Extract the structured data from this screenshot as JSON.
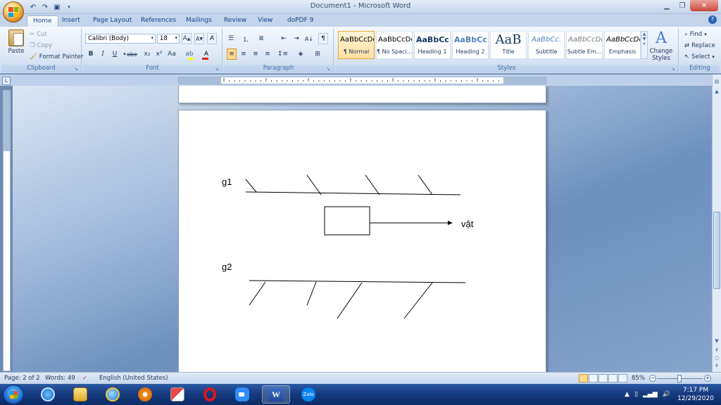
{
  "window": {
    "title": "Document1 - Microsoft Word"
  },
  "tabs": [
    "Home",
    "Insert",
    "Page Layout",
    "References",
    "Mailings",
    "Review",
    "View",
    "doPDF 9"
  ],
  "clipboard": {
    "label": "Clipboard",
    "paste": "Paste",
    "cut": "Cut",
    "copy": "Copy",
    "format_painter": "Format Painter"
  },
  "font": {
    "label": "Font",
    "family": "Calibri (Body)",
    "size": "18",
    "bold": "B",
    "italic": "I",
    "underline": "U",
    "strike": "abe",
    "subscript": "x₂",
    "superscript": "x²",
    "change_case": "Aa",
    "grow": "A",
    "shrink": "A"
  },
  "paragraph": {
    "label": "Paragraph"
  },
  "styles": {
    "label": "Styles",
    "items": [
      {
        "preview": "AaBbCcDc",
        "name": "¶ Normal"
      },
      {
        "preview": "AaBbCcDc",
        "name": "¶ No Spaci..."
      },
      {
        "preview": "AaBbCc",
        "name": "Heading 1"
      },
      {
        "preview": "AaBbCc",
        "name": "Heading 2"
      },
      {
        "preview": "AaB",
        "name": "Title"
      },
      {
        "preview": "AaBbCc.",
        "name": "Subtitle"
      },
      {
        "preview": "AaBbCcDc",
        "name": "Subtle Em..."
      },
      {
        "preview": "AaBbCcDc",
        "name": "Emphasis"
      }
    ],
    "change_styles": "Change Styles"
  },
  "editing": {
    "label": "Editing",
    "find": "Find",
    "replace": "Replace",
    "select": "Select"
  },
  "document": {
    "label_g1": "g1",
    "label_g2": "g2",
    "label_object": "vật"
  },
  "status": {
    "page": "Page: 2 of 2",
    "words": "Words: 49",
    "language": "English (United States)",
    "zoom": "85%"
  },
  "clock": {
    "time": "7:17 PM",
    "date": "12/29/2020"
  },
  "colors": {
    "ribbon_accent": "#15428b",
    "taskbar": "#14397d"
  }
}
